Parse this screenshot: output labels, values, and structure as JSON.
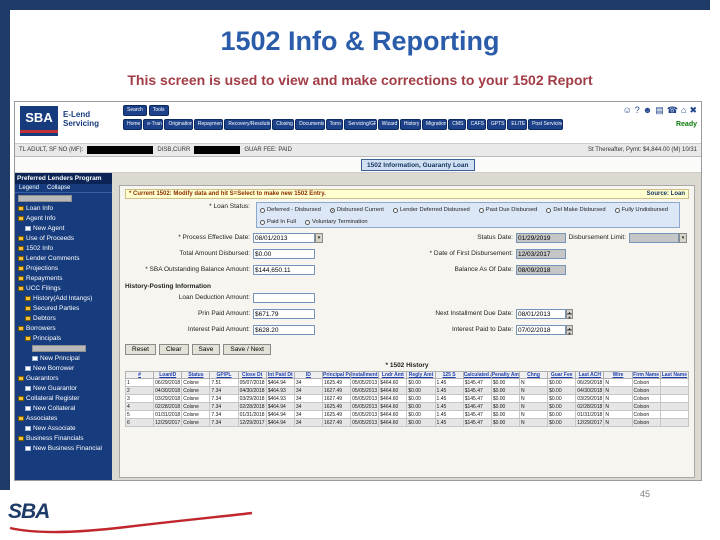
{
  "slide": {
    "title": "1502 Info & Reporting",
    "subtitle": "This screen is used to view and make corrections to your 1502 Report",
    "page_number": "45",
    "logo_text": "SBA"
  },
  "app": {
    "logo_text": "SBA",
    "brand_line1": "E-Lend",
    "brand_line2": "Servicing",
    "top_buttons": [
      "Search",
      "Tools"
    ],
    "nav_buttons": [
      "Home",
      "e-Tran",
      "Origination",
      "Repayment",
      "Recovery/Resolution",
      "Closing",
      "Documents",
      "Torro",
      "Servicing/GP",
      "Wizard",
      "History",
      "Migration",
      "CMS",
      "CAFS",
      "GPTS",
      "ELITE",
      "Post Servicing"
    ],
    "header_icons": [
      {
        "name": "user-icon",
        "glyph": "☺"
      },
      {
        "name": "help-icon",
        "glyph": "?"
      },
      {
        "name": "users-icon",
        "glyph": "☻"
      },
      {
        "name": "print-icon",
        "glyph": "▤"
      },
      {
        "name": "phone-icon",
        "glyph": "☎"
      },
      {
        "name": "home-icon",
        "glyph": "⌂"
      },
      {
        "name": "logout-icon",
        "glyph": "✖"
      }
    ],
    "status_text": "Ready"
  },
  "loanbar": {
    "left": "TL ADULT, SF NO (MF):",
    "mid": "DISB,CURR",
    "mid2": "GUAR FEE: PAID",
    "right": "St Thereafter, Pymt: $4,844.00 (M) 10/31"
  },
  "tab": {
    "label": "1502 Information, Guaranty Loan"
  },
  "sidebar": {
    "title": "Preferred Lenders Program",
    "legend_label": "Legend",
    "collapse_label": "Collapse",
    "items": [
      {
        "label": "",
        "indent": 1,
        "redacted": true
      },
      {
        "label": "Loan Info",
        "indent": 1
      },
      {
        "label": "Agent Info",
        "indent": 1
      },
      {
        "label": "New Agent",
        "indent": 2
      },
      {
        "label": "Use of Proceeds",
        "indent": 1
      },
      {
        "label": "1502 Info",
        "indent": 1
      },
      {
        "label": "Lender Comments",
        "indent": 1
      },
      {
        "label": "Projections",
        "indent": 1
      },
      {
        "label": "Repayments",
        "indent": 1
      },
      {
        "label": "UCC Filings",
        "indent": 1
      },
      {
        "label": "History(Add Intangs)",
        "indent": 2
      },
      {
        "label": "Secured Parties",
        "indent": 2
      },
      {
        "label": "Debtors",
        "indent": 2
      },
      {
        "label": "Borrowers",
        "indent": 1
      },
      {
        "label": "Principals",
        "indent": 2
      },
      {
        "label": "",
        "indent": 3,
        "redacted": true
      },
      {
        "label": "New Principal",
        "indent": 3
      },
      {
        "label": "New Borrower",
        "indent": 2
      },
      {
        "label": "Guarantors",
        "indent": 1
      },
      {
        "label": "New Guarantor",
        "indent": 2
      },
      {
        "label": "Collateral Register",
        "indent": 1
      },
      {
        "label": "New Collateral",
        "indent": 2
      },
      {
        "label": "Associates",
        "indent": 1
      },
      {
        "label": "New Associate",
        "indent": 2
      },
      {
        "label": "Business Financials",
        "indent": 1
      },
      {
        "label": "New Business Financial",
        "indent": 2
      }
    ]
  },
  "form": {
    "note": "* Current 1502: Modify data and hit S=Select to make new 1502 Entry.",
    "source_label": "Source: Loan",
    "loan_status": {
      "label": "* Loan Status:",
      "options_row1": [
        "Deferred - Disbursed",
        "Disbursed Current",
        "Lender Deferred Disbursed",
        "Past Due Disbursed",
        "Del Make Disbursed",
        "Fully Undisbursed"
      ],
      "options_row2": [
        "Paid In Full",
        "Voluntary Termination"
      ],
      "selected": "Disbursed Current"
    },
    "fields": {
      "process_effective_date": {
        "label": "* Process Effective Date:",
        "value": "08/01/2013"
      },
      "status_date": {
        "label": "Status Date:",
        "value": "01/29/2019"
      },
      "disbursement_limit": {
        "label": "Disbursement Limit:",
        "value": ""
      },
      "total_amount_disbursed": {
        "label": "Total Amount Disbursed:",
        "value": "$0.00"
      },
      "date_first_disbursement": {
        "label": "* Date of First Disbursement:",
        "value": "12/03/2017"
      },
      "sba_outstanding_balance": {
        "label": "* SBA Outstanding Balance Amount:",
        "value": "$144,650.11"
      },
      "balance_as_of_date": {
        "label": "Balance As Of Date:",
        "value": "08/09/2018"
      },
      "loan_deduction_amount": {
        "label": "Loan Deduction Amount:",
        "value": ""
      },
      "prin_paid_amount": {
        "label": "Prin Paid Amount:",
        "value": "$671.79"
      },
      "next_installment_due": {
        "label": "Next Installment Due Date:",
        "value": "08/01/2013"
      },
      "interest_paid_amount": {
        "label": "Interest Paid Amount:",
        "value": "$628.20"
      },
      "interest_paid_to_date": {
        "label": "Interest Paid to Date:",
        "value": "07/02/2018"
      }
    },
    "section_title": "History-Posting Information",
    "buttons": [
      "Reset",
      "Clear",
      "Save",
      "Save / Next"
    ]
  },
  "history": {
    "title": "* 1502 History",
    "columns": [
      "#",
      "LoanID",
      "Status",
      "GP/PL",
      "Close Dt",
      "Int Paid Dt",
      "ID",
      "Principal Pay",
      "Installment Due Dt",
      "Lndr Amt",
      "Regly Amt",
      "125 S",
      "Calculated Amt",
      "Penalty Amt",
      "Chng",
      "Guar Fee",
      "Last ACH",
      "Wire",
      "Firm Name",
      "Last Name"
    ],
    "rows": [
      [
        "1",
        "06/29/2018",
        "Colsne",
        "7.51",
        "05/07/2018",
        "$464.94",
        "34",
        "1625.49",
        "05/05/2013",
        "$464.60",
        "$0.00",
        "1.45",
        "$145.47",
        "$0.00",
        "N",
        "$0.00",
        "06/29/2018",
        "N",
        "Colson",
        ""
      ],
      [
        "2",
        "04/30/2018",
        "Colsne",
        "7.34",
        "04/30/2018",
        "$464.93",
        "34",
        "1627.49",
        "05/05/2013",
        "$464.60",
        "$0.00",
        "1.45",
        "$145.47",
        "$0.00",
        "N",
        "$0.00",
        "04/30/2018",
        "N",
        "Colson",
        ""
      ],
      [
        "3",
        "03/29/2018",
        "Colsne",
        "7.34",
        "03/29/2018",
        "$464.93",
        "34",
        "1627.49",
        "05/05/2013",
        "$464.60",
        "$0.00",
        "1.45",
        "$145.47",
        "$0.00",
        "N",
        "$0.00",
        "03/29/2018",
        "N",
        "Colson",
        ""
      ],
      [
        "4",
        "02/28/2018",
        "Colsne",
        "7.34",
        "02/28/2018",
        "$464.94",
        "34",
        "1625.49",
        "05/05/2013",
        "$464.60",
        "$0.00",
        "1.45",
        "$146.47",
        "$0.00",
        "N",
        "$0.00",
        "02/28/2018",
        "N",
        "Colson",
        ""
      ],
      [
        "5",
        "01/31/2018",
        "Colsne",
        "7.34",
        "01/31/2018",
        "$464.94",
        "34",
        "1625.49",
        "05/05/2013",
        "$464.60",
        "$0.00",
        "1.45",
        "$145.47",
        "$0.00",
        "N",
        "$0.00",
        "01/31/2018",
        "N",
        "Colson",
        ""
      ],
      [
        "6",
        "12/29/2017",
        "Colsne",
        "7.34",
        "12/29/2017",
        "$464.94",
        "34",
        "1627.49",
        "05/05/2013",
        "$464.60",
        "$0.00",
        "1.45",
        "$145.47",
        "$0.00",
        "N",
        "$0.00",
        "12/29/2017",
        "N",
        "Colson",
        ""
      ]
    ]
  }
}
